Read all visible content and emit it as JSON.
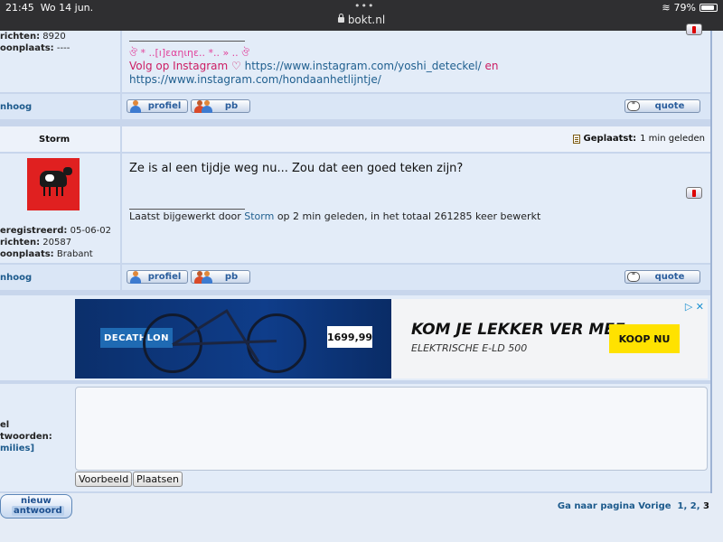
{
  "statusbar": {
    "time": "21:45",
    "date": "Wo 14 jun.",
    "dots": "•••",
    "url": "bokt.nl",
    "battery": "79%"
  },
  "post1": {
    "stats": [
      {
        "label": "richten:",
        "value": "8920"
      },
      {
        "label": "oonplaats:",
        "value": "----"
      }
    ],
    "sig_pink": "ঔ * ..[ı]εαηιηε.. *.. » .. ঔ",
    "sig_text": "Volg op Instagram ♡",
    "sig_url1": "https://www.instagram.com/yoshi_deteckel/",
    "sig_en": "en",
    "sig_url2": "https://www.instagram.com/hondaanhetlijntje/",
    "up_link": "nhoog",
    "btn_profile": "profiel",
    "btn_pm": "pb",
    "btn_quote": "quote"
  },
  "post2": {
    "author": "Storm",
    "posted_label": "Geplaatst:",
    "posted_value": "1 min geleden",
    "text": "Ze is al een tijdje weg nu... Zou dat een goed teken zijn?",
    "edit_prefix": "Laatst bijgewerkt door",
    "edit_user": "Storm",
    "edit_suffix": "op 2 min geleden, in het totaal 261285 keer bewerkt",
    "stats": [
      {
        "label": "eregistreerd:",
        "value": "05-06-02"
      },
      {
        "label": "richten:",
        "value": "20587"
      },
      {
        "label": "oonplaats:",
        "value": "Brabant"
      }
    ],
    "up_link": "nhoog",
    "btn_profile": "profiel",
    "btn_pm": "pb",
    "btn_quote": "quote"
  },
  "ad": {
    "brand": "DECATHLON",
    "price": "1699,99",
    "headline": "KOM JE LEKKER VER MEE",
    "subline": "ELEKTRISCHE E-LD 500",
    "cta": "KOOP NU",
    "adchoice": "▷ ✕"
  },
  "reply": {
    "label1": "el",
    "label2": "twoorden:",
    "smilies": "milies]",
    "preview_btn": "Voorbeeld",
    "post_btn": "Plaatsen"
  },
  "footer": {
    "new_reply_1": "nieuw",
    "new_reply_2": "antwoord",
    "goto": "Ga naar pagina",
    "prev": "Vorige",
    "page1": "1",
    "page2": "2",
    "page3": "3"
  },
  "colors": {
    "accent_link": "#1c5a8c",
    "pink": "#cc1d63",
    "ad_yellow": "#ffe200",
    "ad_blue": "#0f3d8a"
  }
}
